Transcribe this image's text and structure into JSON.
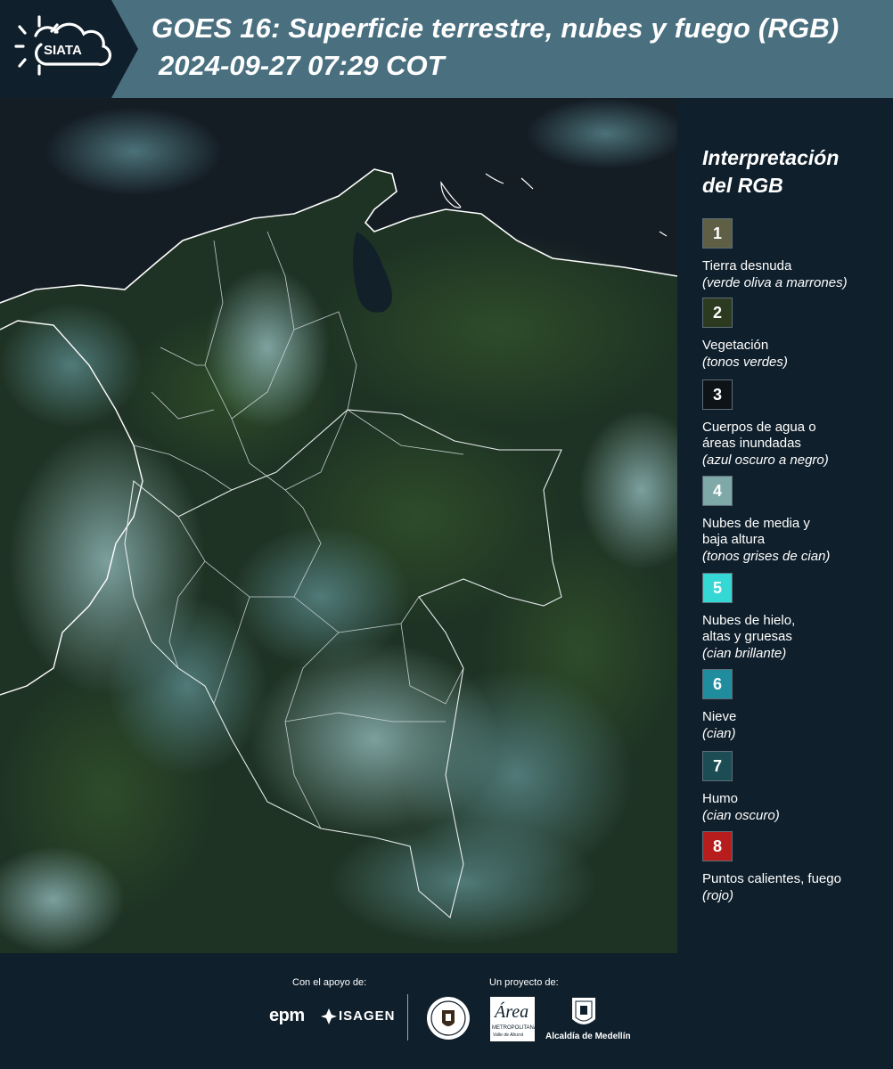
{
  "header": {
    "logo_text": "SIATA",
    "title": "GOES 16: Superficie terrestre, nubes y fuego (RGB)",
    "datetime": "2024-09-27 07:29 COT",
    "background_color": "#4a7080"
  },
  "legend": {
    "title_line1": "Interpretación",
    "title_line2": "del RGB",
    "items": [
      {
        "number": "1",
        "label_lines": [
          "Tierra desnuda"
        ],
        "sub": "(verde oliva a marrones)",
        "color": "#5e5f44"
      },
      {
        "number": "2",
        "label_lines": [
          "Vegetación"
        ],
        "sub": "(tonos verdes)",
        "color": "#2c3a1f"
      },
      {
        "number": "3",
        "label_lines": [
          "Cuerpos de agua o",
          "áreas inundadas"
        ],
        "sub": "(azul oscuro a negro)",
        "color": "#0d1317"
      },
      {
        "number": "4",
        "label_lines": [
          "Nubes de media y",
          "baja altura"
        ],
        "sub": "(tonos grises de cian)",
        "color": "#7fa8a8"
      },
      {
        "number": "5",
        "label_lines": [
          "Nubes de hielo,",
          "altas y gruesas"
        ],
        "sub": "(cian brillante)",
        "color": "#36d8d6"
      },
      {
        "number": "6",
        "label_lines": [
          "Nieve"
        ],
        "sub": "(cian)",
        "color": "#1f8d9e"
      },
      {
        "number": "7",
        "label_lines": [
          "Humo"
        ],
        "sub": "(cian oscuro)",
        "color": "#1d4d54"
      },
      {
        "number": "8",
        "label_lines": [
          "Puntos calientes, fuego"
        ],
        "sub": "(rojo)",
        "color": "#b81d1d"
      }
    ]
  },
  "footer": {
    "support_label": "Con el apoyo de:",
    "project_label": "Un proyecto de:",
    "epm": "epm",
    "isagen": "ISAGEN",
    "area_text": "Área",
    "area_sub": "METROPOLITANA",
    "area_sub2": "Valle de Aburrá",
    "alcaldia": "Alcaldía de Medellín"
  }
}
